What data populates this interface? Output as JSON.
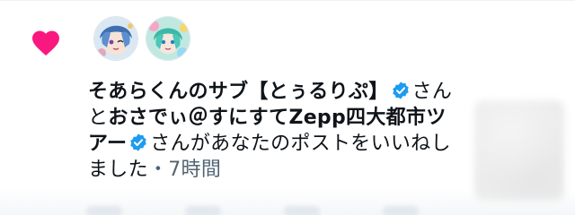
{
  "notification": {
    "name1": "そあらくんのサブ【とぅるりぷ】",
    "connector1": "さんと",
    "name2": "おさでぃ＠すにすてZepp四大都市ツアー",
    "connector2": "さんがあなたのポストをいいねしました",
    "separator": "・",
    "time": "7時間"
  },
  "icons": {
    "like": "heart-icon",
    "verified": "verified-badge-icon"
  },
  "colors": {
    "heart": "#f91880",
    "verified": "#1d9bf0",
    "text": "#0f1419",
    "secondary": "#536471"
  }
}
